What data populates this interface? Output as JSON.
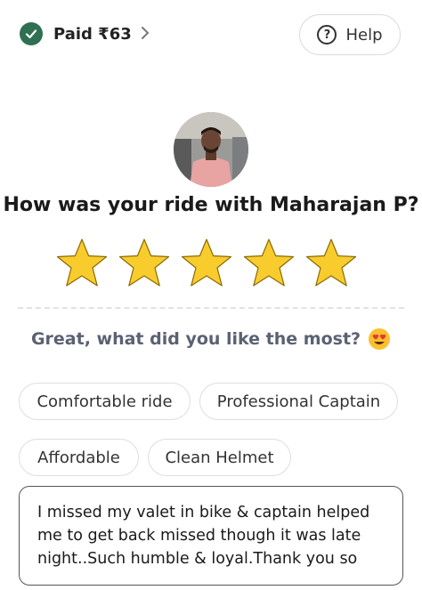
{
  "payment": {
    "status_label": "Paid ₹63",
    "status_icon": "check-icon",
    "chevron_icon": "chevron-right-icon"
  },
  "help": {
    "label": "Help",
    "icon": "question-icon"
  },
  "rating": {
    "question": "How was your ride with Maharajan P?",
    "stars_selected": 5,
    "stars_total": 5,
    "star_color": "#f9cc2e"
  },
  "feedback": {
    "prompt": "Great, what did you like the most?",
    "prompt_emoji": "heart-eyes-emoji",
    "chips": [
      "Comfortable ride",
      "Professional Captain",
      "Affordable",
      "Clean Helmet"
    ],
    "comment": "I missed my valet in bike & captain helped\nme to get back missed  though it was late\nnight..Such humble & loyal.Thank you so"
  },
  "colors": {
    "paid_check": "#2f6f52",
    "prompt_text": "#5a6272"
  }
}
